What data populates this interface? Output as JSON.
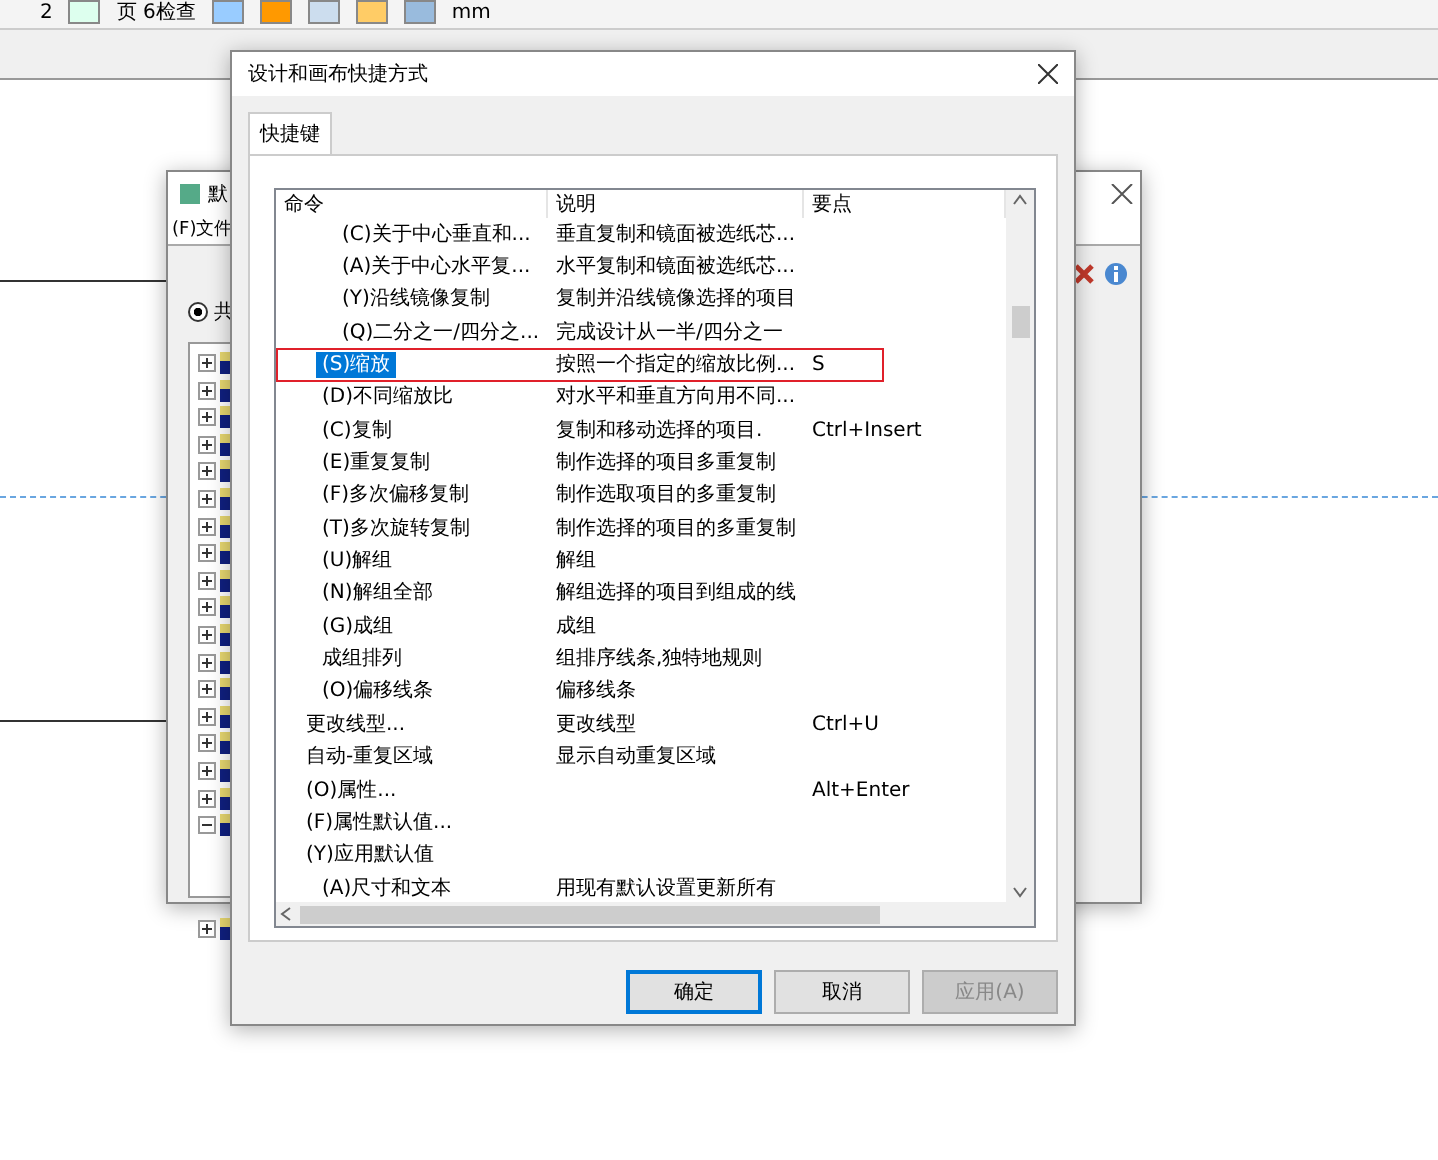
{
  "toolbar": {
    "zoom_value": "2",
    "page_label": "页 6检查",
    "unit": "mm"
  },
  "back_window": {
    "title": "默",
    "menu": "(F)文件",
    "radio": {
      "label": "共",
      "selected": true
    },
    "tree": [
      {
        "expanded": false
      },
      {
        "expanded": false
      },
      {
        "expanded": false
      },
      {
        "expanded": false
      },
      {
        "expanded": false
      },
      {
        "expanded": false
      },
      {
        "expanded": false
      },
      {
        "expanded": false
      },
      {
        "expanded": false
      },
      {
        "expanded": false
      },
      {
        "expanded": false
      },
      {
        "expanded": false
      },
      {
        "expanded": false
      },
      {
        "expanded": false
      },
      {
        "expanded": false
      },
      {
        "expanded": false
      },
      {
        "expanded": false
      },
      {
        "expanded": true
      },
      {
        "expanded": false
      }
    ]
  },
  "dialog": {
    "title": "设计和画布快捷方式",
    "tabs": [
      {
        "label": "快捷键",
        "selected": true
      }
    ],
    "table": {
      "columns": [
        "命令",
        "说明",
        "要点"
      ],
      "rows": [
        {
          "kind": "subsub",
          "command": "(C)关于中心垂直和...",
          "description": "垂直复制和镜面被选纸芯...",
          "key": "",
          "selected": false,
          "annotated": false
        },
        {
          "kind": "subsub",
          "command": "(A)关于中心水平复...",
          "description": "水平复制和镜面被选纸芯...",
          "key": "",
          "selected": false,
          "annotated": false
        },
        {
          "kind": "subsub",
          "command": "(Y)沿线镜像复制",
          "description": "复制并沿线镜像选择的项目",
          "key": "",
          "selected": false,
          "annotated": false
        },
        {
          "kind": "subsub",
          "command": "(Q)二分之一/四分之...",
          "description": "完成设计从一半/四分之一",
          "key": "",
          "selected": false,
          "annotated": false
        },
        {
          "kind": "sub",
          "command": "(S)缩放",
          "description": "按照一个指定的缩放比例...",
          "key": "S",
          "selected": true,
          "annotated": true
        },
        {
          "kind": "sub",
          "command": "(D)不同缩放比",
          "description": "对水平和垂直方向用不同...",
          "key": "",
          "selected": false,
          "annotated": false
        },
        {
          "kind": "sub",
          "command": "(C)复制",
          "description": "复制和移动选择的项目.",
          "key": "Ctrl+Insert",
          "selected": false,
          "annotated": false
        },
        {
          "kind": "sub",
          "command": "(E)重复复制",
          "description": "制作选择的项目多重复制",
          "key": "",
          "selected": false,
          "annotated": false
        },
        {
          "kind": "sub",
          "command": "(F)多次偏移复制",
          "description": "制作选取项目的多重复制",
          "key": "",
          "selected": false,
          "annotated": false
        },
        {
          "kind": "sub",
          "command": "(T)多次旋转复制",
          "description": "制作选择的项目的多重复制",
          "key": "",
          "selected": false,
          "annotated": false
        },
        {
          "kind": "sub",
          "command": "(U)解组",
          "description": "解组",
          "key": "",
          "selected": false,
          "annotated": false
        },
        {
          "kind": "sub",
          "command": "(N)解组全部",
          "description": "解组选择的项目到组成的线",
          "key": "",
          "selected": false,
          "annotated": false
        },
        {
          "kind": "sub",
          "command": "(G)成组",
          "description": "成组",
          "key": "",
          "selected": false,
          "annotated": false
        },
        {
          "kind": "sub",
          "command": "成组排列",
          "description": "组排序线条,独特地规则",
          "key": "",
          "selected": false,
          "annotated": false
        },
        {
          "kind": "sub",
          "command": "(O)偏移线条",
          "description": "偏移线条",
          "key": "",
          "selected": false,
          "annotated": false
        },
        {
          "kind": "top",
          "command": "更改线型...",
          "description": "更改线型",
          "key": "Ctrl+U",
          "selected": false,
          "annotated": false
        },
        {
          "kind": "top",
          "command": "自动-重复区域",
          "description": "显示自动重复区域",
          "key": "",
          "selected": false,
          "annotated": false
        },
        {
          "kind": "top",
          "command": "(O)属性...",
          "description": "",
          "key": "Alt+Enter",
          "selected": false,
          "annotated": false
        },
        {
          "kind": "top",
          "command": "(F)属性默认值...",
          "description": "",
          "key": "",
          "selected": false,
          "annotated": false
        },
        {
          "kind": "top",
          "command": "(Y)应用默认值",
          "description": "",
          "key": "",
          "selected": false,
          "annotated": false
        },
        {
          "kind": "sub",
          "command": "(A)尺寸和文本",
          "description": "用现有默认设置更新所有",
          "key": "",
          "selected": false,
          "annotated": false
        }
      ]
    },
    "buttons": [
      {
        "label": "确定",
        "default": true,
        "disabled": false
      },
      {
        "label": "取消",
        "default": false,
        "disabled": false
      },
      {
        "label": "应用(A)",
        "default": false,
        "disabled": true
      }
    ]
  }
}
